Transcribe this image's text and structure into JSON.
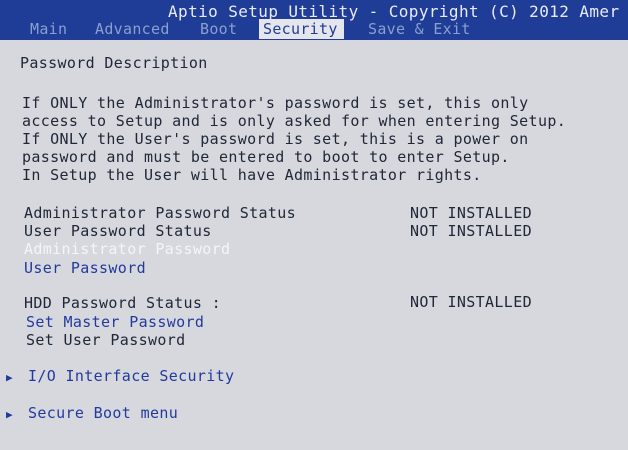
{
  "header": {
    "title": "Aptio Setup Utility - Copyright (C) 2012 Amer",
    "tabs": [
      {
        "label": "Main"
      },
      {
        "label": "Advanced"
      },
      {
        "label": "Boot"
      },
      {
        "label": "Security"
      },
      {
        "label": "Save & Exit"
      }
    ],
    "active_tab": "Security"
  },
  "content": {
    "section_title": "Password Description",
    "description": [
      "If ONLY the Administrator's password is set, this only",
      "access to Setup and is only asked for when entering Setup.",
      "If ONLY the User's password is set, this is a power on",
      "password and must be entered to boot to enter Setup.",
      "In Setup the User will have Administrator rights."
    ],
    "status": {
      "admin_label": "Administrator Password Status",
      "admin_value": "NOT INSTALLED",
      "user_label": "User Password Status",
      "user_value": "NOT INSTALLED"
    },
    "items": {
      "admin_password": "Administrator Password",
      "user_password": "User Password"
    },
    "hdd": {
      "status_label": "HDD Password Status  :",
      "status_value": "NOT INSTALLED",
      "set_master": "Set Master Password",
      "set_user": "Set User Password"
    },
    "submenus": {
      "io_interface": "I/O Interface Security",
      "secure_boot": "Secure Boot menu"
    }
  },
  "colors": {
    "header_bg": "#1f3c96",
    "panel_bg": "#d6d8de",
    "selectable_text": "#233a9c",
    "highlighted_text": "#f4f5f8",
    "static_text": "#202838"
  }
}
